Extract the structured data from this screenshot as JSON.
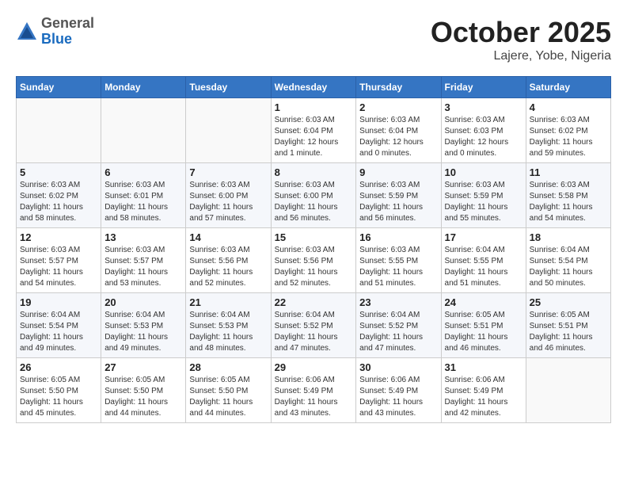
{
  "header": {
    "logo_general": "General",
    "logo_blue": "Blue",
    "title": "October 2025",
    "subtitle": "Lajere, Yobe, Nigeria"
  },
  "calendar": {
    "days_of_week": [
      "Sunday",
      "Monday",
      "Tuesday",
      "Wednesday",
      "Thursday",
      "Friday",
      "Saturday"
    ],
    "weeks": [
      [
        {
          "day": "",
          "info": ""
        },
        {
          "day": "",
          "info": ""
        },
        {
          "day": "",
          "info": ""
        },
        {
          "day": "1",
          "info": "Sunrise: 6:03 AM\nSunset: 6:04 PM\nDaylight: 12 hours\nand 1 minute."
        },
        {
          "day": "2",
          "info": "Sunrise: 6:03 AM\nSunset: 6:04 PM\nDaylight: 12 hours\nand 0 minutes."
        },
        {
          "day": "3",
          "info": "Sunrise: 6:03 AM\nSunset: 6:03 PM\nDaylight: 12 hours\nand 0 minutes."
        },
        {
          "day": "4",
          "info": "Sunrise: 6:03 AM\nSunset: 6:02 PM\nDaylight: 11 hours\nand 59 minutes."
        }
      ],
      [
        {
          "day": "5",
          "info": "Sunrise: 6:03 AM\nSunset: 6:02 PM\nDaylight: 11 hours\nand 58 minutes."
        },
        {
          "day": "6",
          "info": "Sunrise: 6:03 AM\nSunset: 6:01 PM\nDaylight: 11 hours\nand 58 minutes."
        },
        {
          "day": "7",
          "info": "Sunrise: 6:03 AM\nSunset: 6:00 PM\nDaylight: 11 hours\nand 57 minutes."
        },
        {
          "day": "8",
          "info": "Sunrise: 6:03 AM\nSunset: 6:00 PM\nDaylight: 11 hours\nand 56 minutes."
        },
        {
          "day": "9",
          "info": "Sunrise: 6:03 AM\nSunset: 5:59 PM\nDaylight: 11 hours\nand 56 minutes."
        },
        {
          "day": "10",
          "info": "Sunrise: 6:03 AM\nSunset: 5:59 PM\nDaylight: 11 hours\nand 55 minutes."
        },
        {
          "day": "11",
          "info": "Sunrise: 6:03 AM\nSunset: 5:58 PM\nDaylight: 11 hours\nand 54 minutes."
        }
      ],
      [
        {
          "day": "12",
          "info": "Sunrise: 6:03 AM\nSunset: 5:57 PM\nDaylight: 11 hours\nand 54 minutes."
        },
        {
          "day": "13",
          "info": "Sunrise: 6:03 AM\nSunset: 5:57 PM\nDaylight: 11 hours\nand 53 minutes."
        },
        {
          "day": "14",
          "info": "Sunrise: 6:03 AM\nSunset: 5:56 PM\nDaylight: 11 hours\nand 52 minutes."
        },
        {
          "day": "15",
          "info": "Sunrise: 6:03 AM\nSunset: 5:56 PM\nDaylight: 11 hours\nand 52 minutes."
        },
        {
          "day": "16",
          "info": "Sunrise: 6:03 AM\nSunset: 5:55 PM\nDaylight: 11 hours\nand 51 minutes."
        },
        {
          "day": "17",
          "info": "Sunrise: 6:04 AM\nSunset: 5:55 PM\nDaylight: 11 hours\nand 51 minutes."
        },
        {
          "day": "18",
          "info": "Sunrise: 6:04 AM\nSunset: 5:54 PM\nDaylight: 11 hours\nand 50 minutes."
        }
      ],
      [
        {
          "day": "19",
          "info": "Sunrise: 6:04 AM\nSunset: 5:54 PM\nDaylight: 11 hours\nand 49 minutes."
        },
        {
          "day": "20",
          "info": "Sunrise: 6:04 AM\nSunset: 5:53 PM\nDaylight: 11 hours\nand 49 minutes."
        },
        {
          "day": "21",
          "info": "Sunrise: 6:04 AM\nSunset: 5:53 PM\nDaylight: 11 hours\nand 48 minutes."
        },
        {
          "day": "22",
          "info": "Sunrise: 6:04 AM\nSunset: 5:52 PM\nDaylight: 11 hours\nand 47 minutes."
        },
        {
          "day": "23",
          "info": "Sunrise: 6:04 AM\nSunset: 5:52 PM\nDaylight: 11 hours\nand 47 minutes."
        },
        {
          "day": "24",
          "info": "Sunrise: 6:05 AM\nSunset: 5:51 PM\nDaylight: 11 hours\nand 46 minutes."
        },
        {
          "day": "25",
          "info": "Sunrise: 6:05 AM\nSunset: 5:51 PM\nDaylight: 11 hours\nand 46 minutes."
        }
      ],
      [
        {
          "day": "26",
          "info": "Sunrise: 6:05 AM\nSunset: 5:50 PM\nDaylight: 11 hours\nand 45 minutes."
        },
        {
          "day": "27",
          "info": "Sunrise: 6:05 AM\nSunset: 5:50 PM\nDaylight: 11 hours\nand 44 minutes."
        },
        {
          "day": "28",
          "info": "Sunrise: 6:05 AM\nSunset: 5:50 PM\nDaylight: 11 hours\nand 44 minutes."
        },
        {
          "day": "29",
          "info": "Sunrise: 6:06 AM\nSunset: 5:49 PM\nDaylight: 11 hours\nand 43 minutes."
        },
        {
          "day": "30",
          "info": "Sunrise: 6:06 AM\nSunset: 5:49 PM\nDaylight: 11 hours\nand 43 minutes."
        },
        {
          "day": "31",
          "info": "Sunrise: 6:06 AM\nSunset: 5:49 PM\nDaylight: 11 hours\nand 42 minutes."
        },
        {
          "day": "",
          "info": ""
        }
      ]
    ]
  }
}
